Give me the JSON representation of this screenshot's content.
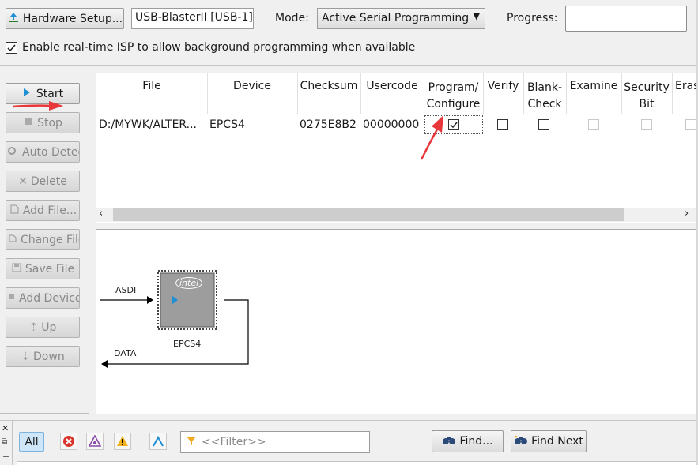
{
  "top": {
    "hardware_button": "Hardware Setup...",
    "hardware_value": "USB-BlasterII [USB-1]",
    "mode_label": "Mode:",
    "mode_value": "Active Serial Programming",
    "progress_label": "Progress:",
    "progress_value": "",
    "isp_label": "Enable real-time ISP to allow background programming when available"
  },
  "sidebar": {
    "buttons": [
      {
        "label": "Start",
        "enabled": true
      },
      {
        "label": "Stop",
        "enabled": false
      },
      {
        "label": "Auto Detect",
        "enabled": false
      },
      {
        "label": "Delete",
        "enabled": false
      },
      {
        "label": "Add File...",
        "enabled": false
      },
      {
        "label": "Change File",
        "enabled": false
      },
      {
        "label": "Save File",
        "enabled": false
      },
      {
        "label": "Add Device",
        "enabled": false
      },
      {
        "label": "Up",
        "enabled": false
      },
      {
        "label": "Down",
        "enabled": false
      }
    ]
  },
  "table": {
    "headers": {
      "file": "File",
      "device": "Device",
      "checksum": "Checksum",
      "usercode": "Usercode",
      "program1": "Program/",
      "program2": "Configure",
      "verify": "Verify",
      "blank1": "Blank-",
      "blank2": "Check",
      "examine": "Examine",
      "security1": "Security",
      "security2": "Bit",
      "erase": "Erase"
    },
    "row": {
      "file": "D:/MYWK/ALTER...",
      "device": "EPCS4",
      "checksum": "0275E8B2",
      "usercode": "00000000",
      "program": true,
      "verify": false,
      "blank_check": false
    }
  },
  "diagram": {
    "chip_brand": "intel",
    "in_label": "ASDI",
    "out_label": "DATA",
    "device_label": "EPCS4"
  },
  "bottom": {
    "all_label": "All",
    "filter_placeholder": "<<Filter>>",
    "find_label": "Find...",
    "find_next_label": "Find Next"
  },
  "colors": {
    "annotation_arrow": "#e8373a",
    "play_blue": "#1f8fd6",
    "chip_gray": "#9d9d9d"
  }
}
